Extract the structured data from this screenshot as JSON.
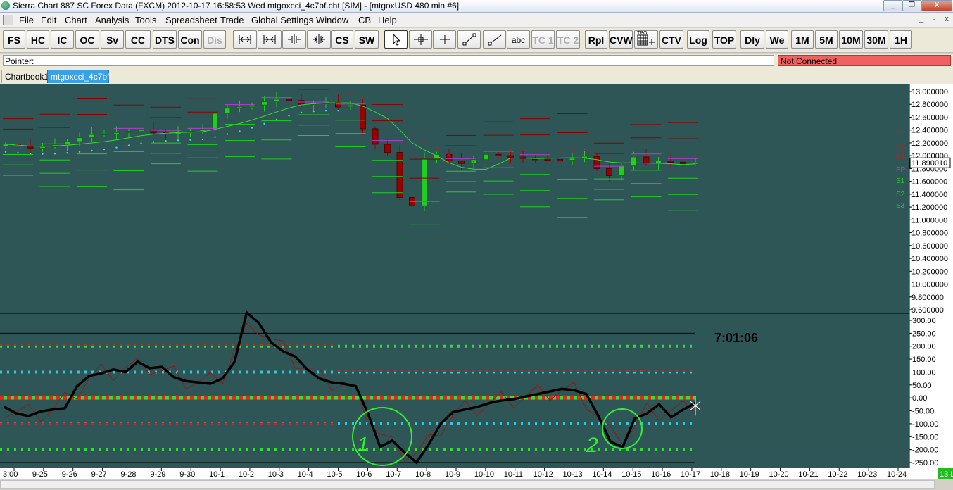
{
  "window": {
    "title": "Sierra Chart 887 SC Forex Data (FXCM) 2012-10-17  16:58:53 Wed  mtgoxcci_4c7bf.cht [SIM] - [mtgoxUSD  480 min   #6]",
    "minimize_glyph": "_",
    "restore_glyph": "❐",
    "close_glyph": "X"
  },
  "menu": {
    "items": [
      "File",
      "Edit",
      "Chart",
      "Analysis",
      "Tools",
      "Spreadsheet",
      "Trade",
      "Global Settings",
      "Window",
      "CB",
      "Help"
    ],
    "mdi_min": "_",
    "mdi_restore": "▫",
    "mdi_close": "x"
  },
  "toolbar": {
    "text_buttons": [
      {
        "label": "FS",
        "disabled": false
      },
      {
        "label": "HC",
        "disabled": false
      },
      {
        "label": "IC",
        "disabled": false
      },
      {
        "label": "OC",
        "disabled": false
      },
      {
        "label": "Sv",
        "disabled": false
      },
      {
        "label": "CC",
        "disabled": false
      },
      {
        "label": "DTS",
        "disabled": false
      },
      {
        "label": "Con",
        "disabled": false
      },
      {
        "label": "Dis",
        "disabled": true
      }
    ],
    "icon_buttons_a": [
      "scale-expand-icon",
      "scale-compress-icon",
      "bar-spacing-expand-icon",
      "bar-spacing-compress-icon"
    ],
    "text_buttons_b": [
      {
        "label": "CS"
      },
      {
        "label": "SW"
      }
    ],
    "tool_icons": [
      "pointer-arrow-icon",
      "crosshair-icon",
      "cross-small-icon",
      "line-tool-icon",
      "ray-tool-icon"
    ],
    "text_buttons_c": [
      {
        "label": "abc",
        "disabled": false,
        "small": true
      },
      {
        "label": "TC 1",
        "disabled": true
      },
      {
        "label": "TC 2",
        "disabled": true
      }
    ],
    "text_buttons_d": [
      {
        "label": "Rpl"
      },
      {
        "label": "CVW"
      }
    ],
    "tpo_label": "TPO",
    "text_buttons_e": [
      {
        "label": "CTV"
      },
      {
        "label": "Log"
      },
      {
        "label": "TOP"
      },
      {
        "label": "Dly"
      },
      {
        "label": "We"
      },
      {
        "label": "1M"
      },
      {
        "label": "5M"
      },
      {
        "label": "10M"
      },
      {
        "label": "30M"
      },
      {
        "label": "1H"
      }
    ]
  },
  "pointer": {
    "label": "Pointer:",
    "status": "Not Connected",
    "status_color": "#f06262"
  },
  "tabs": [
    {
      "label": "Chartbook1",
      "active": false
    },
    {
      "label": "mtgoxcci_4c7bf",
      "active": true
    }
  ],
  "chart": {
    "symbol": "mtgoxUSD",
    "interval": "480 min",
    "background": "#2f5656",
    "price_axis": [
      "13.000000",
      "12.800000",
      "12.600000",
      "12.400000",
      "12.200000",
      "12.000000",
      "11.800000",
      "11.600000",
      "11.400000",
      "11.200000",
      "11.000000",
      "10.800000",
      "10.600000",
      "10.400000",
      "10.200000",
      "10.000000",
      "9.800000",
      "9.600000"
    ],
    "last_price": "11.890010",
    "pivot_labels": [
      {
        "text": "R3",
        "color": "#b22222"
      },
      {
        "text": "R2",
        "color": "#b22222"
      },
      {
        "text": "R1",
        "color": "#b22222"
      },
      {
        "text": "PP",
        "color": "#c23bd4"
      },
      {
        "text": "S1",
        "color": "#22cc22"
      },
      {
        "text": "S2",
        "color": "#22cc22"
      },
      {
        "text": "S3",
        "color": "#22cc22"
      }
    ],
    "cci_axis": [
      "300.00",
      "250.00",
      "200.00",
      "150.00",
      "100.00",
      "50.00",
      "0.00",
      "-50.00",
      "-100.00",
      "-150.00",
      "-200.00",
      "-250.00"
    ],
    "countdown": "7:01:06",
    "dates": [
      "3:00",
      "9-25",
      "9-26",
      "9-27",
      "9-28",
      "9-29",
      "9-30",
      "10-1",
      "10-2",
      "10-3",
      "10-4",
      "10-5",
      "10-6",
      "10-7",
      "10-8",
      "10-9",
      "10-10",
      "10-11",
      "10-12",
      "10-13",
      "10-14",
      "10-15",
      "10-16",
      "10-17",
      "10-18",
      "10-19",
      "10-20",
      "10-21",
      "10-22",
      "10-23",
      "10-24"
    ],
    "annotations": [
      "1",
      "2"
    ],
    "corner_label": "13 L",
    "colors": {
      "up": "#22cc22",
      "down": "#990000",
      "ma": "#33dd33",
      "cci": "#000000",
      "cci_slow": "#8b1a1a",
      "r_level": "#8b0000",
      "s_level": "#22cc22",
      "pp_level": "#b040d0"
    }
  },
  "chart_data": {
    "type": "candlestick",
    "x_unit": "480-minute bars",
    "price_ylim": [
      9.6,
      13.0
    ],
    "cci_ylim": [
      -250,
      300
    ],
    "ohlc_close_estimates": [
      12.18,
      12.15,
      12.12,
      12.14,
      12.17,
      12.22,
      12.28,
      12.33,
      12.35,
      12.36,
      12.38,
      12.4,
      12.36,
      12.34,
      12.36,
      12.38,
      12.41,
      12.66,
      12.74,
      12.76,
      12.79,
      12.84,
      12.88,
      12.86,
      12.8,
      12.82,
      12.83,
      12.76,
      12.79,
      12.42,
      12.18,
      12.05,
      11.35,
      11.22,
      11.95,
      12.02,
      11.92,
      11.88,
      11.94,
      12.02,
      12.0,
      11.98,
      11.96,
      11.95,
      11.94,
      11.93,
      11.96,
      11.99,
      11.8,
      11.69,
      11.84,
      11.98,
      11.88,
      11.92,
      11.9,
      11.88,
      11.89
    ],
    "cci_estimates": [
      -35,
      -60,
      -70,
      -52,
      -45,
      -40,
      45,
      85,
      95,
      110,
      100,
      140,
      115,
      120,
      80,
      65,
      60,
      55,
      75,
      140,
      330,
      290,
      215,
      180,
      160,
      110,
      75,
      60,
      55,
      45,
      -60,
      -190,
      -165,
      -210,
      -250,
      -180,
      -100,
      -55,
      -45,
      -35,
      -20,
      -10,
      -5,
      5,
      15,
      25,
      35,
      30,
      15,
      -70,
      -170,
      -190,
      -80,
      -60,
      -25,
      -75,
      -45,
      -20
    ]
  }
}
